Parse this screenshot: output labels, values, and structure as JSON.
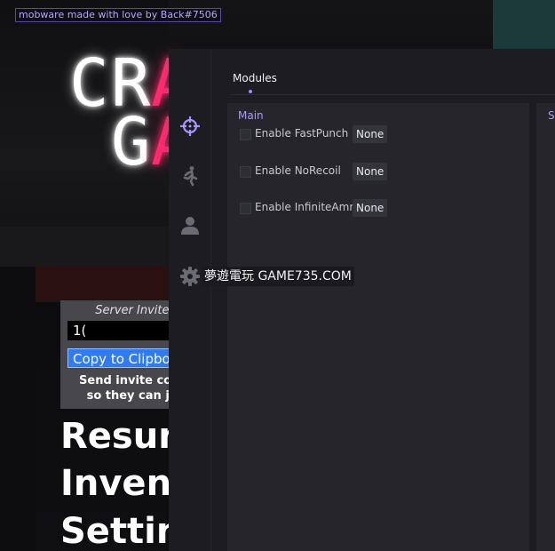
{
  "watermark_top": "mobware made with love by Back#7506",
  "logo": {
    "line1": [
      "C",
      "R",
      "A"
    ],
    "line2": [
      "G",
      "A"
    ]
  },
  "invite": {
    "title": "Server Invite C",
    "code": "1(",
    "copy_button": "Copy to Clipboa",
    "description_line1": "Send invite code t",
    "description_line2": "so they can join"
  },
  "pause_menu": [
    "Resum",
    "Invento",
    "Setting"
  ],
  "menu": {
    "tab_label": "Modules",
    "sidebar_icons": [
      "crosshair-icon",
      "running-icon",
      "user-icon",
      "gear-icon"
    ],
    "accent_color": "#9d8bff",
    "panel_main_title": "Main",
    "panel_second_title": "Se",
    "modules": [
      {
        "label": "Enable FastPunch",
        "key": "None"
      },
      {
        "label": "Enable NoRecoil",
        "key": "None"
      },
      {
        "label": "Enable InfiniteAmmo",
        "key": "None"
      }
    ]
  },
  "watermark_mid": "夢遊電玩 GAME735.COM"
}
